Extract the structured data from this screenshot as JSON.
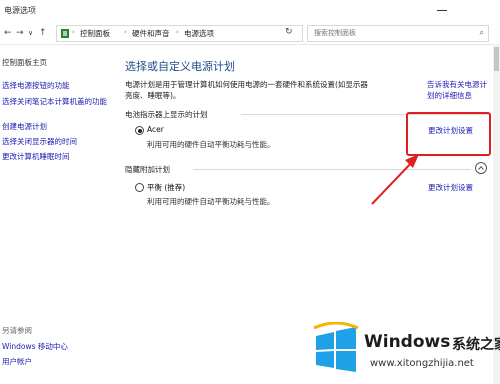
{
  "window": {
    "title": "电源选项"
  },
  "nav": {
    "back": "←",
    "forward": "→",
    "history": "∨",
    "up": "↑",
    "breadcrumbs": [
      "控制面板",
      "硬件和声音",
      "电源选项"
    ],
    "search_placeholder": "搜索控制面板"
  },
  "sidebar": {
    "home": "控制面板主页",
    "links": [
      "选择电源按钮的功能",
      "选择关闭笔记本计算机盖的功能",
      "创建电源计划",
      "选择关闭显示器的时间",
      "更改计算机睡眠时间"
    ],
    "see_also_title": "另请参阅",
    "see_also": [
      "Windows 移动中心",
      "用户帐户"
    ]
  },
  "main": {
    "heading": "选择或自定义电源计划",
    "description": "电源计划是用于管理计算机如何使用电源的一套硬件和系统设置(如显示器亮度、睡眠等)。",
    "description_link": "告诉我有关电源计划的详细信息",
    "section_battery": "电池指示器上显示的计划",
    "section_hidden": "隐藏附加计划",
    "plans": [
      {
        "name": "Acer",
        "desc": "利用可用的硬件自动平衡功耗与性能。",
        "change": "更改计划设置",
        "selected": true
      },
      {
        "name": "平衡 (推荐)",
        "desc": "利用可用的硬件自动平衡功耗与性能。",
        "change": "更改计划设置",
        "selected": false
      }
    ]
  },
  "watermark": {
    "brand": "Windows",
    "cn": "系统之家",
    "url": "www.xitongzhijia.net"
  },
  "colors": {
    "link": "#1b1bb3",
    "heading": "#1e4d8c",
    "highlight": "#e02020"
  }
}
